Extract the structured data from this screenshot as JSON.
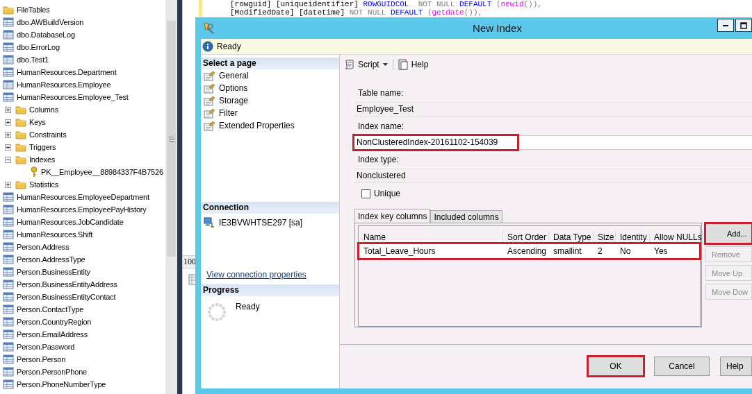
{
  "object_explorer": {
    "items": [
      {
        "label": "FileTables",
        "kind": "folder"
      },
      {
        "label": "dbo.AWBuildVersion",
        "kind": "table"
      },
      {
        "label": "dbo.DatabaseLog",
        "kind": "table"
      },
      {
        "label": "dbo.ErrorLog",
        "kind": "table"
      },
      {
        "label": "dbo.Test1",
        "kind": "table"
      },
      {
        "label": "HumanResources.Department",
        "kind": "table"
      },
      {
        "label": "HumanResources.Employee",
        "kind": "table"
      },
      {
        "label": "HumanResources.Employee_Test",
        "kind": "table",
        "children": [
          {
            "label": "Columns",
            "kind": "folder",
            "expanded": false
          },
          {
            "label": "Keys",
            "kind": "folder",
            "expanded": false
          },
          {
            "label": "Constraints",
            "kind": "folder",
            "expanded": false
          },
          {
            "label": "Triggers",
            "kind": "folder",
            "expanded": false
          },
          {
            "label": "Indexes",
            "kind": "folder",
            "expanded": true,
            "children": [
              {
                "label": "PK__Employee__88984337F4B7526",
                "kind": "key"
              }
            ]
          },
          {
            "label": "Statistics",
            "kind": "folder",
            "expanded": false
          }
        ]
      },
      {
        "label": "HumanResources.EmployeeDepartment",
        "kind": "table"
      },
      {
        "label": "HumanResources.EmployeePayHistory",
        "kind": "table"
      },
      {
        "label": "HumanResources.JobCandidate",
        "kind": "table"
      },
      {
        "label": "HumanResources.Shift",
        "kind": "table"
      },
      {
        "label": "Person.Address",
        "kind": "table"
      },
      {
        "label": "Person.AddressType",
        "kind": "table"
      },
      {
        "label": "Person.BusinessEntity",
        "kind": "table"
      },
      {
        "label": "Person.BusinessEntityAddress",
        "kind": "table"
      },
      {
        "label": "Person.BusinessEntityContact",
        "kind": "table"
      },
      {
        "label": "Person.ContactType",
        "kind": "table"
      },
      {
        "label": "Person.CountryRegion",
        "kind": "table"
      },
      {
        "label": "Person.EmailAddress",
        "kind": "table"
      },
      {
        "label": "Person.Password",
        "kind": "table"
      },
      {
        "label": "Person.Person",
        "kind": "table"
      },
      {
        "label": "Person.PersonPhone",
        "kind": "table"
      },
      {
        "label": "Person.PhoneNumberType",
        "kind": "table"
      }
    ]
  },
  "editor": {
    "code_lines": [
      [
        {
          "text": "[rowguid] [uniqueidentifier] ",
          "kind": "plain"
        },
        {
          "text": "ROWGUIDCOL",
          "kind": "keyword"
        },
        {
          "text": "  NOT NULL ",
          "kind": "operator"
        },
        {
          "text": "DEFAULT",
          "kind": "keyword"
        },
        {
          "text": " (",
          "kind": "operator"
        },
        {
          "text": "newid",
          "kind": "function"
        },
        {
          "text": "()),",
          "kind": "operator"
        }
      ],
      [
        {
          "text": "[ModifiedDate] [datetime] ",
          "kind": "plain"
        },
        {
          "text": "NOT NULL ",
          "kind": "operator"
        },
        {
          "text": "DEFAULT",
          "kind": "keyword"
        },
        {
          "text": " (",
          "kind": "operator"
        },
        {
          "text": "getdate",
          "kind": "function"
        },
        {
          "text": "()),",
          "kind": "operator"
        }
      ]
    ],
    "zoom": "100"
  },
  "dialog": {
    "title": "New Index",
    "status": "Ready",
    "pages_header": "Select a page",
    "pages": [
      "General",
      "Options",
      "Storage",
      "Filter",
      "Extended Properties"
    ],
    "connection_header": "Connection",
    "connection": "IE3BVWHTSE297 [sa]",
    "connection_link": "View connection properties",
    "progress_header": "Progress",
    "progress_status": "Ready",
    "toolbar": {
      "script": "Script",
      "help": "Help"
    },
    "fields": [
      {
        "label": "Table name:",
        "value": "Employee_Test",
        "editable": false,
        "highlighted": false
      },
      {
        "label": "Index name:",
        "value": "NonClusteredIndex-20161102-154039",
        "editable": true,
        "highlighted": true
      },
      {
        "label": "Index type:",
        "value": "Nonclustered",
        "editable": false,
        "highlighted": false
      }
    ],
    "unique": {
      "label": "Unique",
      "checked": false
    },
    "tabs": [
      {
        "label": "Index key columns",
        "selected": true
      },
      {
        "label": "Included columns",
        "selected": false
      }
    ],
    "grid": {
      "columns": [
        "Name",
        "Sort Order",
        "Data Type",
        "Size",
        "Identity",
        "Allow NULLs"
      ],
      "rows": [
        {
          "cells": [
            "Total_Leave_Hours",
            "Ascending",
            "smallint",
            "2",
            "No",
            "Yes"
          ],
          "highlighted": true
        }
      ]
    },
    "side_buttons": [
      {
        "label": "Add...",
        "disabled": false,
        "highlighted": true
      },
      {
        "label": "Remove",
        "disabled": true,
        "highlighted": false
      },
      {
        "label": "Move Up",
        "disabled": true,
        "highlighted": false
      },
      {
        "label": "Move Dow",
        "disabled": true,
        "highlighted": false
      }
    ],
    "footer_buttons": [
      {
        "label": "OK",
        "default": true,
        "highlighted": true
      },
      {
        "label": "Cancel",
        "default": false,
        "highlighted": false
      },
      {
        "label": "Help",
        "default": false,
        "highlighted": false
      }
    ]
  }
}
